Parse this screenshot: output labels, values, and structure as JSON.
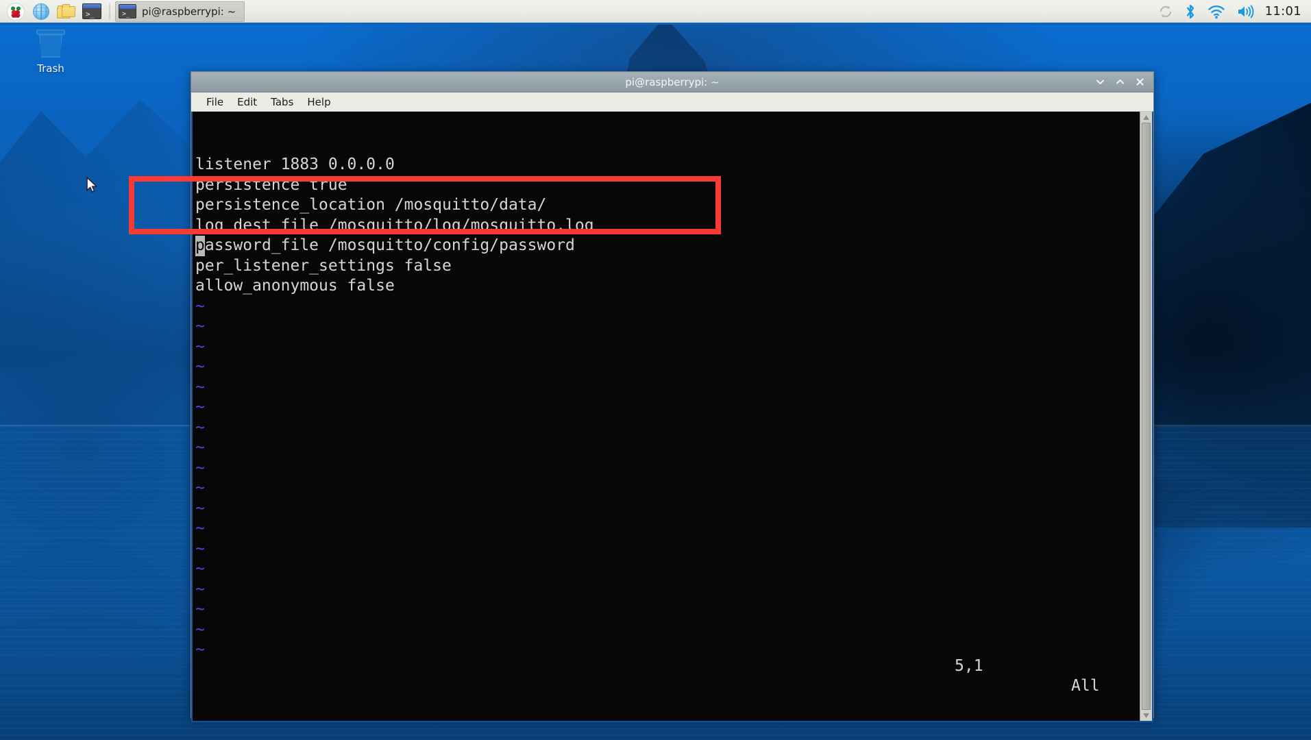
{
  "taskbar": {
    "launchers": [
      {
        "name": "raspberry-menu",
        "icon": "raspberry-icon",
        "label": ""
      },
      {
        "name": "web-browser",
        "icon": "globe-icon",
        "label": ""
      },
      {
        "name": "file-manager",
        "icon": "folders-icon",
        "label": ""
      },
      {
        "name": "terminal-launcher",
        "icon": "terminal-icon",
        "label": ""
      }
    ],
    "window_button": {
      "label": "pi@raspberrypi: ~",
      "icon": "terminal-icon"
    },
    "tray": [
      {
        "name": "cpu-usage-icon",
        "icon": "refresh-circle-icon"
      },
      {
        "name": "bluetooth-icon",
        "icon": "bluetooth-icon"
      },
      {
        "name": "wifi-icon",
        "icon": "wifi-icon"
      },
      {
        "name": "volume-icon",
        "icon": "speaker-icon"
      }
    ],
    "clock": "11:01"
  },
  "desktop": {
    "icons": [
      {
        "name": "trash",
        "label": "Trash",
        "icon": "trash-icon"
      }
    ]
  },
  "terminal": {
    "title": "pi@raspberrypi: ~",
    "window_controls": [
      {
        "name": "minimize-button",
        "glyph": "chevron-down-icon"
      },
      {
        "name": "maximize-button",
        "glyph": "chevron-up-icon"
      },
      {
        "name": "close-button",
        "glyph": "close-icon"
      }
    ],
    "menus": [
      {
        "label": "File"
      },
      {
        "label": "Edit"
      },
      {
        "label": "Tabs"
      },
      {
        "label": "Help"
      }
    ],
    "content_lines": [
      "listener 1883 0.0.0.0",
      "persistence true",
      "persistence_location /mosquitto/data/",
      "log_dest file /mosquitto/log/mosquitto.log",
      "password_file /mosquitto/config/password",
      "per_listener_settings false",
      "allow_anonymous false"
    ],
    "cursor_line_index": 4,
    "cursor_char": "p",
    "empty_line_marker": "~",
    "empty_line_count": 18,
    "status": {
      "position": "5,1",
      "scroll": "All"
    }
  },
  "annotation": {
    "name": "red-highlight-box",
    "color": "#fb3a34",
    "highlights": [
      "log_dest file /mosquitto/log/mosquitto.log",
      "password_file /mosquitto/config/password",
      "per_listener_settings false"
    ]
  },
  "colors": {
    "accent_blue": "#0b63bd",
    "annotation_red": "#fb3a34",
    "terminal_bg": "#070707",
    "terminal_fg": "#d6d6d6",
    "tilde_blue": "#4848e8",
    "titlebar": "#99a5ad"
  }
}
